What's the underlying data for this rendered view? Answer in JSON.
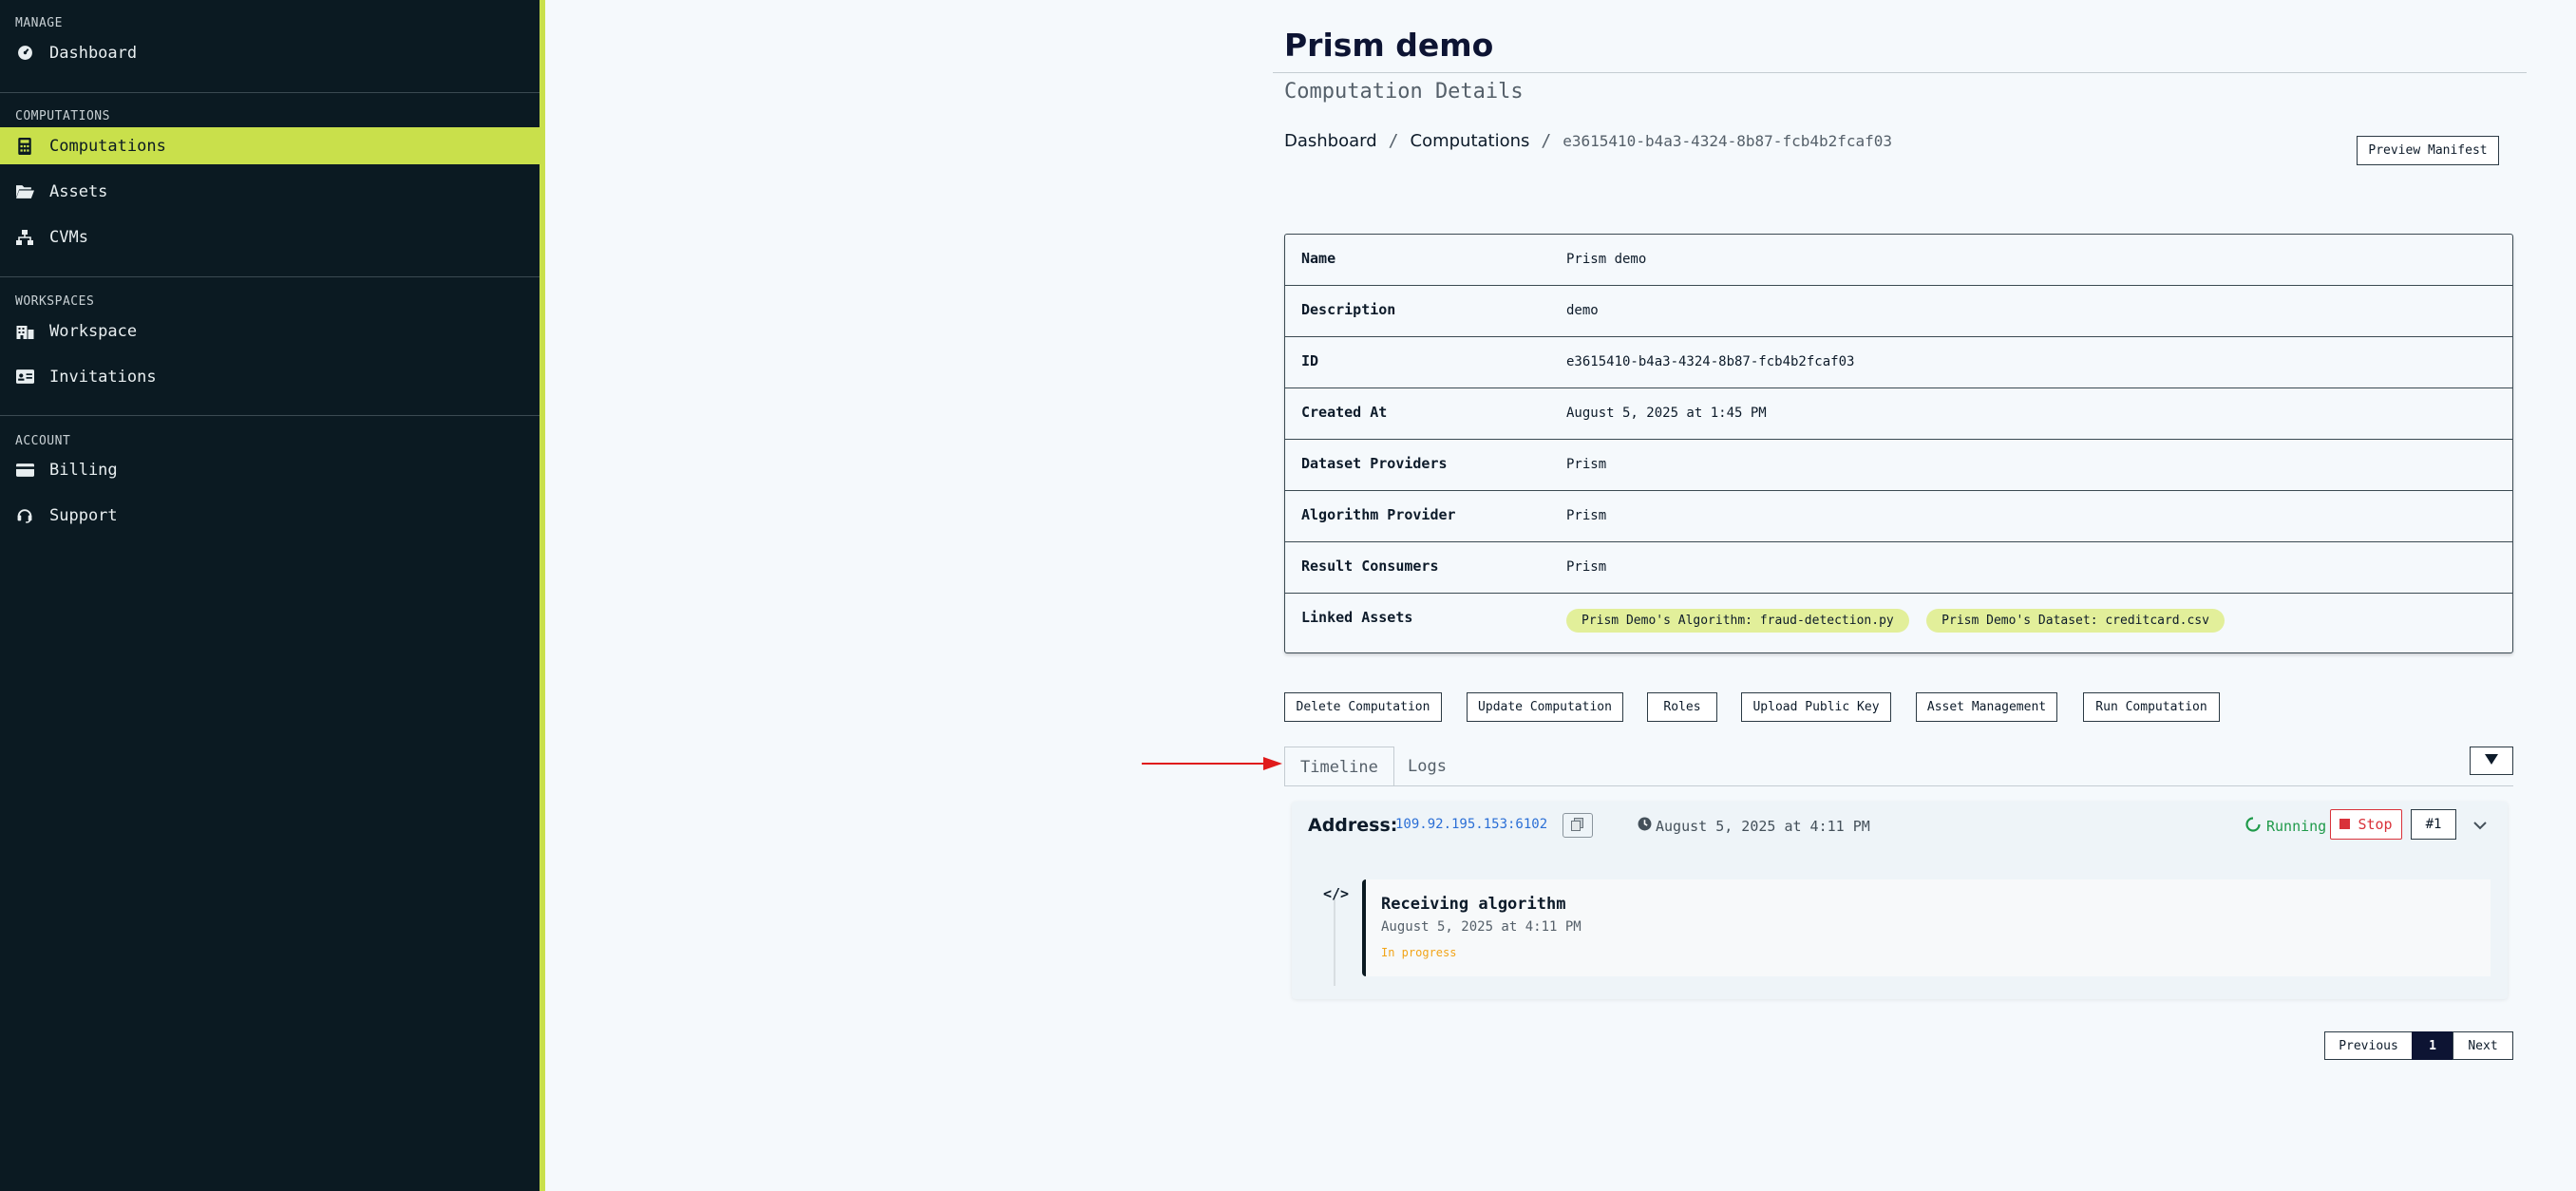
{
  "sidebar": {
    "sections": [
      {
        "label": "MANAGE",
        "items": [
          {
            "label": "Dashboard",
            "icon": "gauge-icon"
          }
        ]
      },
      {
        "label": "COMPUTATIONS",
        "items": [
          {
            "label": "Computations",
            "icon": "calculator-icon",
            "active": true
          },
          {
            "label": "Assets",
            "icon": "folder-open-icon"
          },
          {
            "label": "CVMs",
            "icon": "network-icon"
          }
        ]
      },
      {
        "label": "WORKSPACES",
        "items": [
          {
            "label": "Workspace",
            "icon": "building-icon"
          },
          {
            "label": "Invitations",
            "icon": "id-card-icon"
          }
        ]
      },
      {
        "label": "ACCOUNT",
        "items": [
          {
            "label": "Billing",
            "icon": "credit-card-icon"
          },
          {
            "label": "Support",
            "icon": "headset-icon"
          }
        ]
      }
    ],
    "accent_color": "#c9e04b"
  },
  "header": {
    "title": "Prism demo",
    "subtitle": "Computation Details",
    "breadcrumb": [
      "Dashboard",
      "Computations",
      "e3615410-b4a3-4324-8b87-fcb4b2fcaf03"
    ],
    "preview_manifest_label": "Preview Manifest"
  },
  "details": {
    "rows": [
      {
        "key": "Name",
        "value": "Prism demo"
      },
      {
        "key": "Description",
        "value": "demo"
      },
      {
        "key": "ID",
        "value": "e3615410-b4a3-4324-8b87-fcb4b2fcaf03"
      },
      {
        "key": "Created At",
        "value": "August 5, 2025 at 1:45 PM"
      },
      {
        "key": "Dataset Providers",
        "value": "Prism"
      },
      {
        "key": "Algorithm Provider",
        "value": "Prism"
      },
      {
        "key": "Result Consumers",
        "value": "Prism"
      },
      {
        "key": "Linked Assets",
        "value": ""
      }
    ],
    "linked_assets": [
      "Prism Demo's Algorithm: fraud-detection.py",
      "Prism Demo's Dataset: creditcard.csv"
    ]
  },
  "actions": [
    "Delete Computation",
    "Update Computation",
    "Roles",
    "Upload Public Key",
    "Asset Management",
    "Run Computation"
  ],
  "tabs": [
    {
      "label": "Timeline",
      "active": true
    },
    {
      "label": "Logs",
      "active": false
    }
  ],
  "filter_toggle_icon": "triangle-down-icon",
  "run": {
    "address_label": "Address:",
    "address": "109.92.195.153:6102",
    "timestamp": "August 5, 2025 at 4:11 PM",
    "status": "Running",
    "stop_label": "Stop",
    "run_number": "#1",
    "steps": [
      {
        "title": "Receiving algorithm",
        "timestamp": "August 5, 2025 at 4:11 PM",
        "status": "In progress"
      }
    ]
  },
  "pagination": {
    "previous": "Previous",
    "current": "1",
    "next": "Next"
  }
}
